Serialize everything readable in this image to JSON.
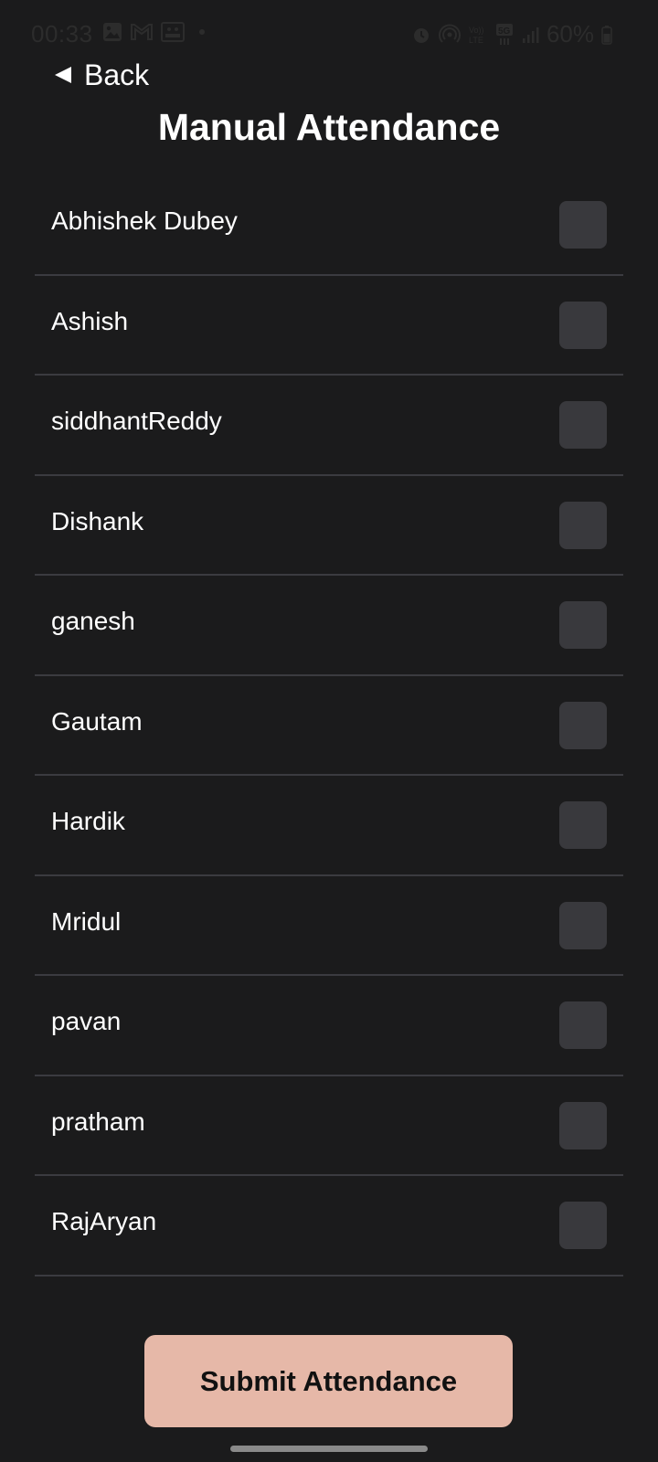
{
  "status_bar": {
    "time": "00:33",
    "battery_percent": "60%",
    "left_icons": [
      "gallery-icon",
      "gmail-icon",
      "photos-icon",
      "notification-dot"
    ],
    "right_icons": [
      "alarm-icon",
      "hotspot-icon",
      "volte-icon",
      "5g-icon",
      "signal-icon",
      "battery-icon"
    ]
  },
  "header": {
    "back_label": "Back",
    "title": "Manual Attendance"
  },
  "students": [
    {
      "name": "Abhishek Dubey",
      "checked": false
    },
    {
      "name": "Ashish",
      "checked": false
    },
    {
      "name": "siddhantReddy",
      "checked": false
    },
    {
      "name": "Dishank",
      "checked": false
    },
    {
      "name": "ganesh",
      "checked": false
    },
    {
      "name": "Gautam",
      "checked": false
    },
    {
      "name": "Hardik",
      "checked": false
    },
    {
      "name": "Mridul",
      "checked": false
    },
    {
      "name": "pavan",
      "checked": false
    },
    {
      "name": "pratham",
      "checked": false
    },
    {
      "name": "RajAryan",
      "checked": false
    }
  ],
  "submit": {
    "label": "Submit Attendance"
  },
  "colors": {
    "background": "#1b1b1c",
    "checkbox": "#39393d",
    "divider": "#3b3b40",
    "submit_bg": "#e6b8a8"
  }
}
